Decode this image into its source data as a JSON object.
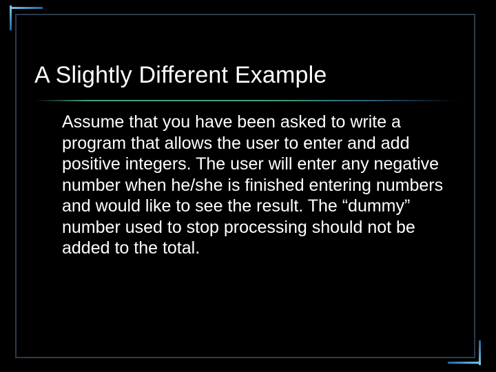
{
  "slide": {
    "title": "A Slightly Different Example",
    "body": "Assume that you have been asked to write a program that allows the user to enter and add positive integers.  The user will enter any negative number when he/she is finished entering numbers and would like to see the result.  The “dummy” number used to stop processing should not be added to the total."
  }
}
